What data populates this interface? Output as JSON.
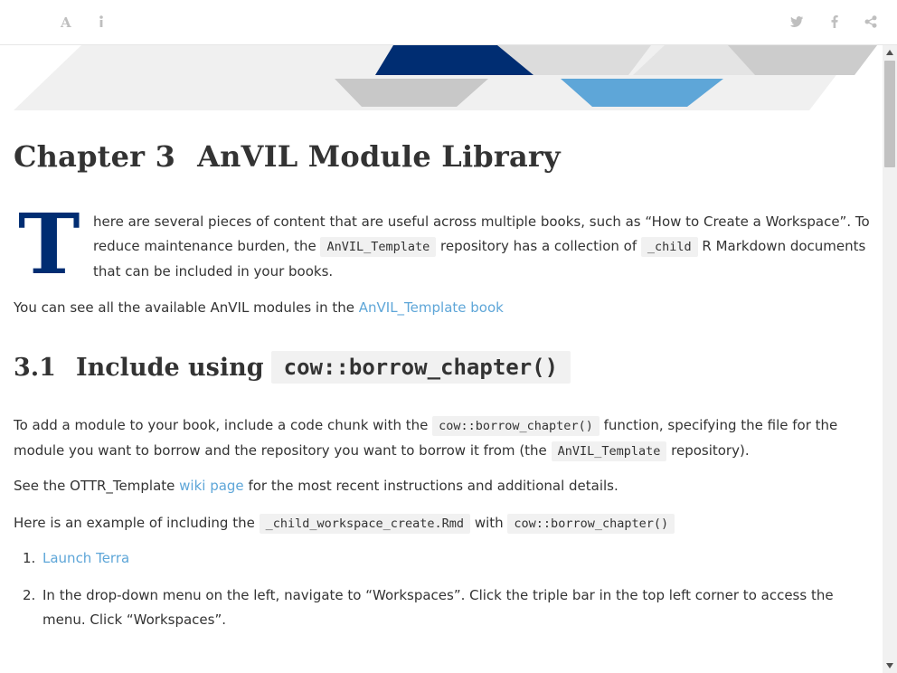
{
  "toolbar": {
    "left_icons": [
      "font-settings-icon",
      "info-icon"
    ],
    "right_icons": [
      "twitter-icon",
      "facebook-icon",
      "share-icon"
    ]
  },
  "colors": {
    "dropcap": "#002d72",
    "link": "#5ea6d8",
    "banner_dark_blue": "#002d72",
    "banner_light_blue": "#5ea6d8",
    "banner_gray": "#c8c8c8"
  },
  "chapter": {
    "number": "Chapter 3",
    "title": "AnVIL Module Library"
  },
  "intro": {
    "dropcap": "T",
    "text1": "here are several pieces of content that are useful across multiple books, such as “How to Create a Workspace”. To reduce maintenance burden, the ",
    "code1": "AnVIL_Template",
    "text2": " repository has a collection of ",
    "code2": "_child",
    "text3": " R Markdown documents that can be included in your books."
  },
  "modules_line": {
    "text": "You can see all the available AnVIL modules in the ",
    "link": "AnVIL_Template book"
  },
  "section": {
    "number": "3.1",
    "title": "Include using",
    "code": "cow::borrow_chapter()"
  },
  "para_add": {
    "text1": "To add a module to your book, include a code chunk with the ",
    "code1": "cow::borrow_chapter()",
    "text2": " function, specifying the file for the module you want to borrow and the repository you want to borrow it from (the ",
    "code2": "AnVIL_Template",
    "text3": " repository)."
  },
  "para_see": {
    "text1": "See the OTTR_Template ",
    "link": "wiki page",
    "text2": " for the most recent instructions and additional details."
  },
  "para_example": {
    "text1": "Here is an example of including the ",
    "code1": "_child_workspace_create.Rmd",
    "text2": " with ",
    "code2": "cow::borrow_chapter()"
  },
  "steps": [
    {
      "num": "1.",
      "link": "Launch Terra",
      "text": ""
    },
    {
      "num": "2.",
      "link": "",
      "text": "In the drop-down menu on the left, navigate to “Workspaces”. Click the triple bar in the top left corner to access the menu. Click “Workspaces”."
    }
  ]
}
